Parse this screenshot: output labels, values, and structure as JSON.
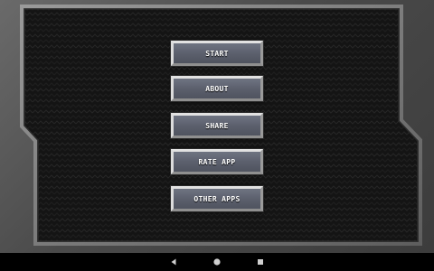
{
  "menu": {
    "items": [
      {
        "label": "START"
      },
      {
        "label": "ABOUT"
      },
      {
        "label": "SHARE"
      },
      {
        "label": "RATE APP"
      },
      {
        "label": "OTHER APPS"
      }
    ]
  },
  "navigation_bar": {
    "buttons": [
      "back-icon",
      "home-icon",
      "recent-apps-icon"
    ]
  },
  "colors": {
    "frame": "#5a5a5a",
    "panel_background": "#151515",
    "button_fill": "#5c606d",
    "button_border": "#c9c9c9",
    "label": "#ffffff",
    "nav_bar": "#000000"
  }
}
